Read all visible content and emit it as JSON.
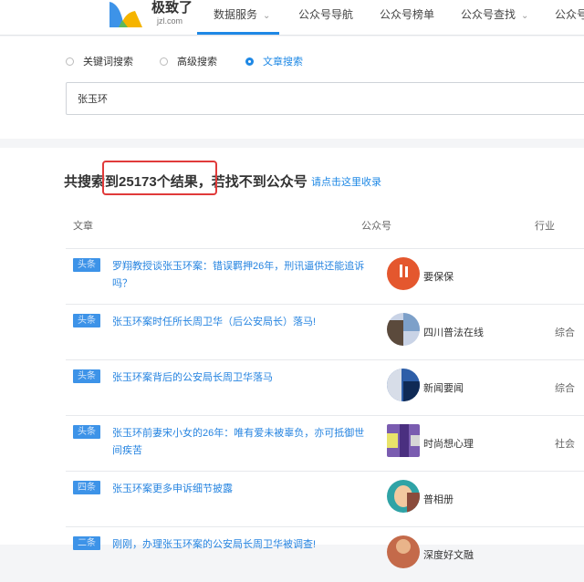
{
  "header": {
    "logo_title": "极致了",
    "logo_sub": "jzl.com",
    "nav": [
      {
        "label": "数据服务",
        "caret": "⌄"
      },
      {
        "label": "公众号导航",
        "caret": ""
      },
      {
        "label": "公众号榜单",
        "caret": ""
      },
      {
        "label": "公众号查找",
        "caret": "⌄"
      },
      {
        "label": "公众号",
        "caret": ""
      }
    ]
  },
  "search": {
    "options": [
      "关键词搜索",
      "高级搜索",
      "文章搜索"
    ],
    "selected_option": "文章搜索",
    "query": "张玉环"
  },
  "results": {
    "summary_prefix": "共搜索到",
    "count": "25173",
    "summary_suffix": "个结果，若找不到公众号",
    "submit_link": "请点击这里收录",
    "columns": {
      "article": "文章",
      "account": "公众号",
      "industry": "行业"
    },
    "rows": [
      {
        "tag": "头条",
        "title": "罗翔教授谈张玉环案：错误羁押26年，刑讯逼供还能追诉吗？",
        "account": "要保保",
        "industry": ""
      },
      {
        "tag": "头条",
        "title": "张玉环案时任所长周卫华（后公安局长）落马!",
        "account": "四川普法在线",
        "industry": "综合"
      },
      {
        "tag": "头条",
        "title": "张玉环案背后的公安局长周卫华落马",
        "account": "新闻要闻",
        "industry": "综合"
      },
      {
        "tag": "头条",
        "title": "张玉环前妻宋小女的26年：唯有爱未被辜负，亦可抵御世间疾苦",
        "account": "时尚想心理",
        "industry": "社会"
      },
      {
        "tag": "四条",
        "title": "张玉环案更多申诉细节披露",
        "account": "普相册",
        "industry": ""
      },
      {
        "tag": "二条",
        "title": "刚刚，办理张玉环案的公安局长周卫华被调查!",
        "account": "深度好文融",
        "industry": ""
      }
    ]
  },
  "colors": {
    "accent": "#1e88e5",
    "tag_bg": "#3d93e8",
    "highlight": "#e03a3a"
  }
}
